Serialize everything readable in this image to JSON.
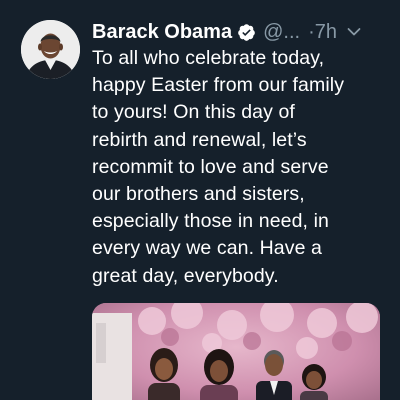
{
  "tweet": {
    "author_name": "Barack Obama",
    "handle": "@...",
    "time_sep": "·",
    "time": "7h",
    "verified": true,
    "body_lines": [
      "To all who celebrate today,",
      "happy Easter from our family",
      "to yours! On this day of",
      "rebirth and renewal, let’s",
      "recommit to love and serve",
      "our brothers and sisters,",
      "especially those in need, in",
      "every way we can. Have a",
      "great day, everybody."
    ]
  },
  "icons": {
    "verified": "verified-badge-icon",
    "more": "chevron-down-icon"
  },
  "colors": {
    "background": "#15202b",
    "text": "#ffffff",
    "secondary_text": "#8899a6",
    "verified_fill": "#ffffff"
  }
}
